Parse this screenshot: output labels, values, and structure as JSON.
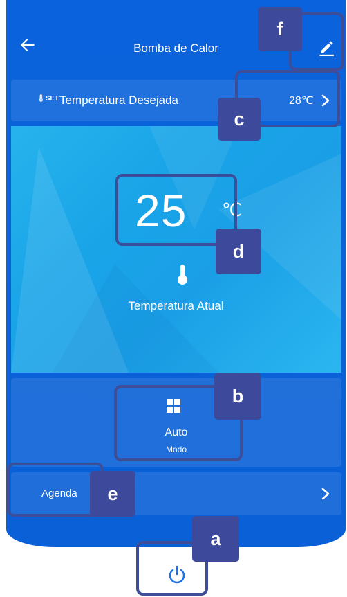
{
  "header": {
    "title": "Bomba de Calor",
    "back_icon": "arrow-left-icon",
    "edit_icon": "pencil-icon"
  },
  "target_temperature": {
    "icon_text": "SET",
    "label": "Temperatura Desejada",
    "value": "28℃"
  },
  "current_temperature": {
    "value": "25",
    "unit": "℃",
    "label": "Temperatura Atual"
  },
  "mode": {
    "icon": "grid-icon",
    "name": "Auto",
    "label": "Modo"
  },
  "agenda": {
    "label": "Agenda"
  },
  "power": {
    "icon": "power-icon"
  },
  "annotations": {
    "a": "a",
    "b": "b",
    "c": "c",
    "d": "d",
    "e": "e",
    "f": "f"
  },
  "colors": {
    "primary_blue": "#0a63dc",
    "panel_light": "#1ea7e9",
    "annotation": "#3d4a9b"
  }
}
